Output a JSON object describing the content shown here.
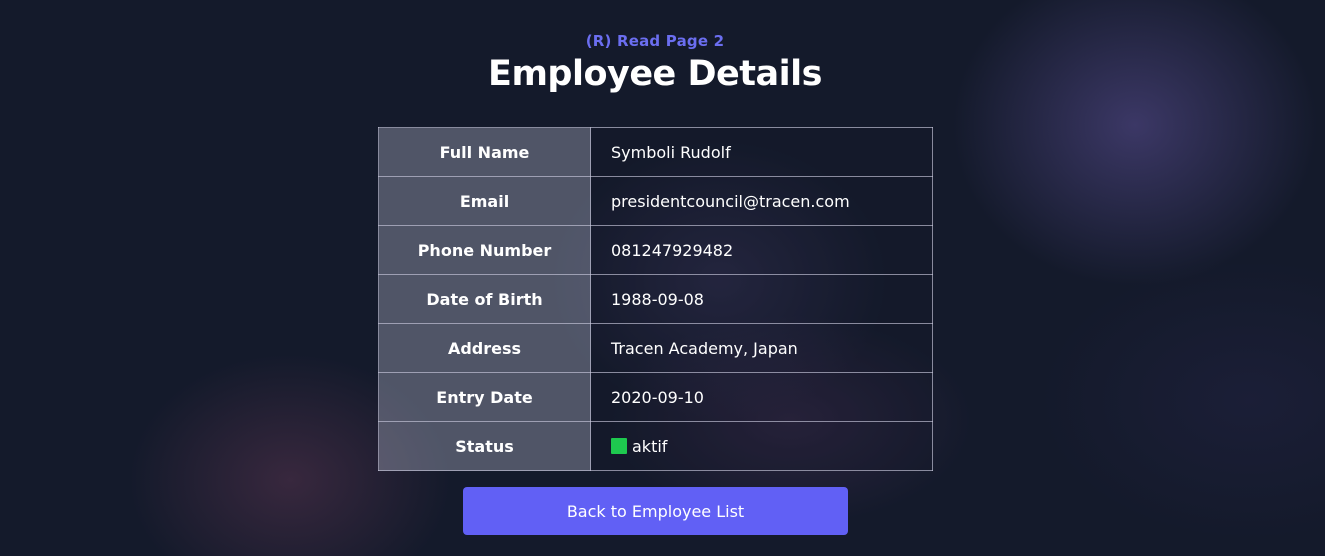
{
  "header": {
    "subtitle": "(R) Read Page 2",
    "title": "Employee Details"
  },
  "details": {
    "rows": [
      {
        "label": "Full Name",
        "value": "Symboli Rudolf"
      },
      {
        "label": "Email",
        "value": "presidentcouncil@tracen.com"
      },
      {
        "label": "Phone Number",
        "value": "081247929482"
      },
      {
        "label": "Date of Birth",
        "value": "1988-09-08"
      },
      {
        "label": "Address",
        "value": "Tracen Academy, Japan"
      },
      {
        "label": "Entry Date",
        "value": "2020-09-10"
      },
      {
        "label": "Status",
        "value": "aktif",
        "indicator_color": "#1ec94f"
      }
    ]
  },
  "actions": {
    "back_label": "Back to Employee List"
  },
  "colors": {
    "accent": "#6160f5",
    "subtitle": "#6b6ef0",
    "background": "#141a2b"
  }
}
